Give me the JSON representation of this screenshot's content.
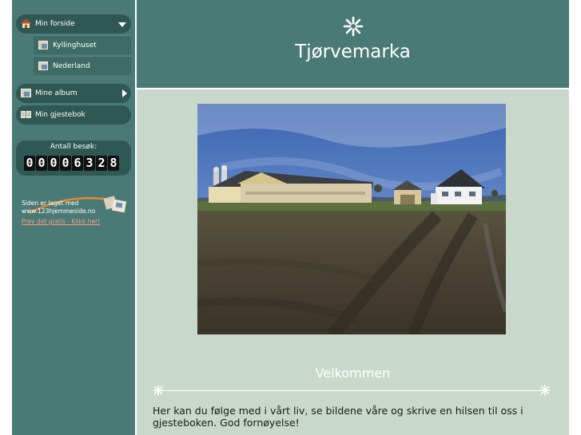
{
  "site": {
    "title": "Tjørvemarka"
  },
  "nav": {
    "home": "Min forside",
    "sub_items": [
      {
        "label": "Kyllinghuset"
      },
      {
        "label": "Nederland"
      }
    ],
    "albums": "Mine album",
    "guestbook": "Min gjestebok"
  },
  "counter": {
    "label": "Antall besøk:",
    "digits": [
      "0",
      "0",
      "0",
      "0",
      "6",
      "3",
      "2",
      "8"
    ]
  },
  "promo": {
    "line1": "Siden er laget med",
    "line2": "www.123hjemmeside.no",
    "link": "Prøv det gratis - Klikk her!"
  },
  "main": {
    "welcome": "Velkommen",
    "intro": "Her kan du følge med i vårt liv, se bildene våre og skrive en hilsen til oss i gjesteboken. God fornøyelse!"
  },
  "colors": {
    "primary": "#4a7a76",
    "pill": "#2f5854",
    "background": "#c8d9cb",
    "link": "#ff9a80"
  },
  "icons": {
    "home": "house-icon",
    "album": "photo-album-icon",
    "guestbook": "book-icon",
    "ornament": "snowflake-icon"
  }
}
